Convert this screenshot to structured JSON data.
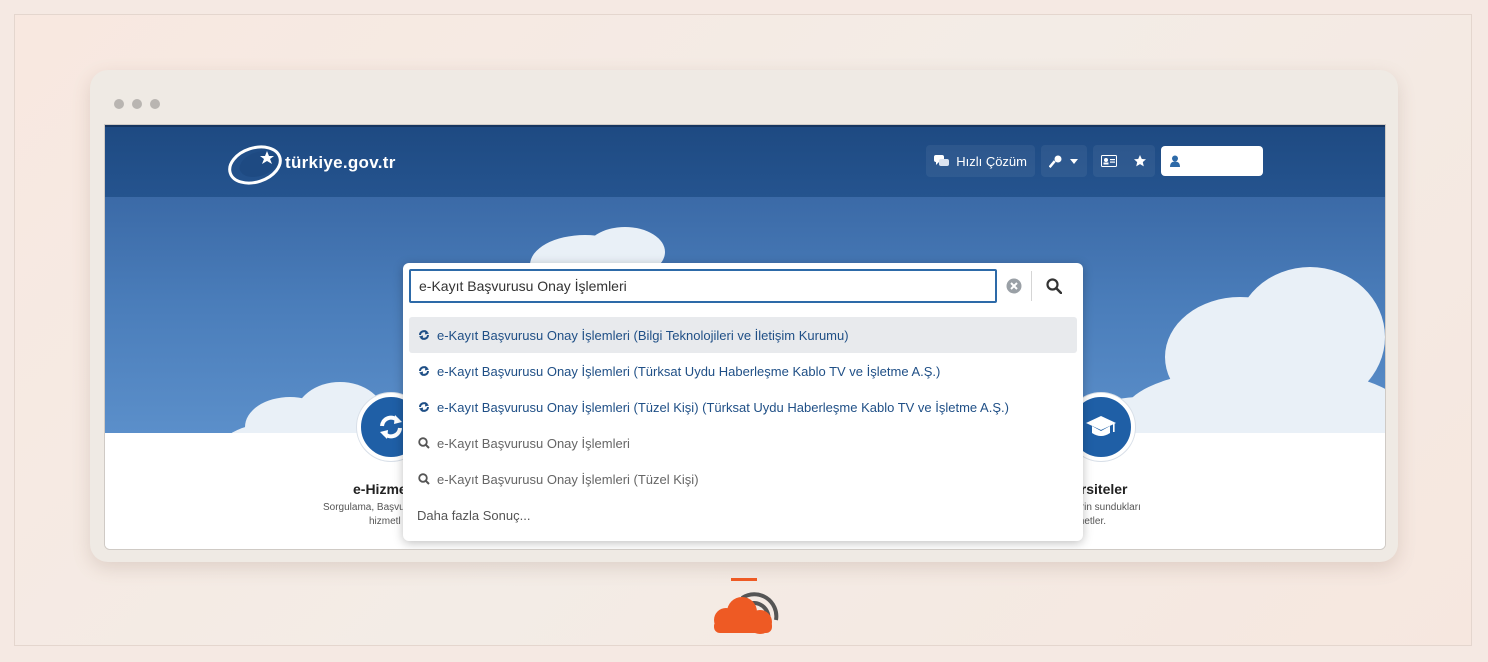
{
  "site": {
    "logo_text": "türkiye.gov.tr"
  },
  "header": {
    "quick_solution_label": "Hızlı Çözüm"
  },
  "search": {
    "value": "e-Kayıt Başvurusu Onay İşlemleri",
    "results": [
      {
        "type": "service",
        "label": "e-Kayıt Başvurusu Onay İşlemleri (Bilgi Teknolojileri ve İletişim Kurumu)",
        "highlighted": true
      },
      {
        "type": "service",
        "label": "e-Kayıt Başvurusu Onay İşlemleri (Türksat Uydu Haberleşme Kablo TV ve İşletme A.Ş.)"
      },
      {
        "type": "service",
        "label": "e-Kayıt Başvurusu Onay İşlemleri (Tüzel Kişi) (Türksat Uydu Haberleşme Kablo TV ve İşletme A.Ş.)"
      },
      {
        "type": "query",
        "label": "e-Kayıt Başvurusu Onay İşlemleri"
      },
      {
        "type": "query",
        "label": "e-Kayıt Başvurusu Onay İşlemleri (Tüzel Kişi)"
      }
    ],
    "more_label": "Daha fazla Sonuç..."
  },
  "tiles": {
    "left": {
      "title": "e-Hizme",
      "desc_line1": "Sorgulama, Başvu",
      "desc_line2": "hizmetl"
    },
    "right": {
      "title": "ersiteler",
      "desc_line1": "lerin sundukları",
      "desc_line2": "zmetler."
    }
  },
  "colors": {
    "header": "#1e4a82",
    "accent": "#2d6aa8",
    "tile_icon": "#1f5fa6",
    "brand": "#ee5a24"
  }
}
